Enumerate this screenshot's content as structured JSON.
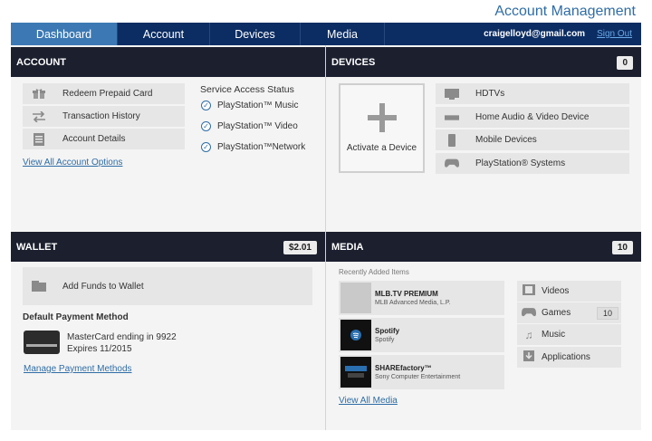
{
  "header": {
    "title": "Account Management"
  },
  "nav": {
    "tabs": [
      "Dashboard",
      "Account",
      "Devices",
      "Media"
    ],
    "email": "craigelloyd@gmail.com",
    "signout": "Sign Out"
  },
  "account": {
    "heading": "ACCOUNT",
    "items": [
      {
        "label": "Redeem Prepaid Card",
        "icon": "gift-icon"
      },
      {
        "label": "Transaction History",
        "icon": "transfer-icon"
      },
      {
        "label": "Account Details",
        "icon": "details-icon"
      }
    ],
    "service_heading": "Service Access Status",
    "services": [
      "PlayStation™ Music",
      "PlayStation™ Video",
      "PlayStation™Network"
    ],
    "view_all": "View All Account Options"
  },
  "devices": {
    "heading": "DEVICES",
    "count": "0",
    "activate": "Activate a Device",
    "items": [
      {
        "label": "HDTVs",
        "icon": "tv-icon"
      },
      {
        "label": "Home Audio & Video Device",
        "icon": "audio-device-icon"
      },
      {
        "label": "Mobile Devices",
        "icon": "mobile-icon"
      },
      {
        "label": "PlayStation® Systems",
        "icon": "gamepad-icon"
      }
    ]
  },
  "wallet": {
    "heading": "WALLET",
    "balance": "$2.01",
    "add_funds": "Add Funds to Wallet",
    "default_heading": "Default Payment Method",
    "card_line1": "MasterCard ending in 9922",
    "card_line2": "Expires 11/2015",
    "manage": "Manage Payment Methods"
  },
  "media": {
    "heading": "MEDIA",
    "count": "10",
    "recent_heading": "Recently Added Items",
    "recent": [
      {
        "title": "MLB.TV PREMIUM",
        "publisher": "MLB Advanced Media, L.P."
      },
      {
        "title": "Spotify",
        "publisher": "Spotify"
      },
      {
        "title": "SHAREfactory™",
        "publisher": "Sony Computer Entertainment"
      }
    ],
    "view_all": "View All Media",
    "categories": [
      {
        "label": "Videos",
        "icon": "film-icon",
        "count": ""
      },
      {
        "label": "Games",
        "icon": "gamepad-icon",
        "count": "10"
      },
      {
        "label": "Music",
        "icon": "music-note-icon",
        "count": ""
      },
      {
        "label": "Applications",
        "icon": "download-icon",
        "count": ""
      }
    ]
  },
  "colors": {
    "nav_bg": "#0c2d63",
    "active_tab": "#3c79b4",
    "panel_header": "#1b1f2e",
    "link": "#2f6da6"
  }
}
